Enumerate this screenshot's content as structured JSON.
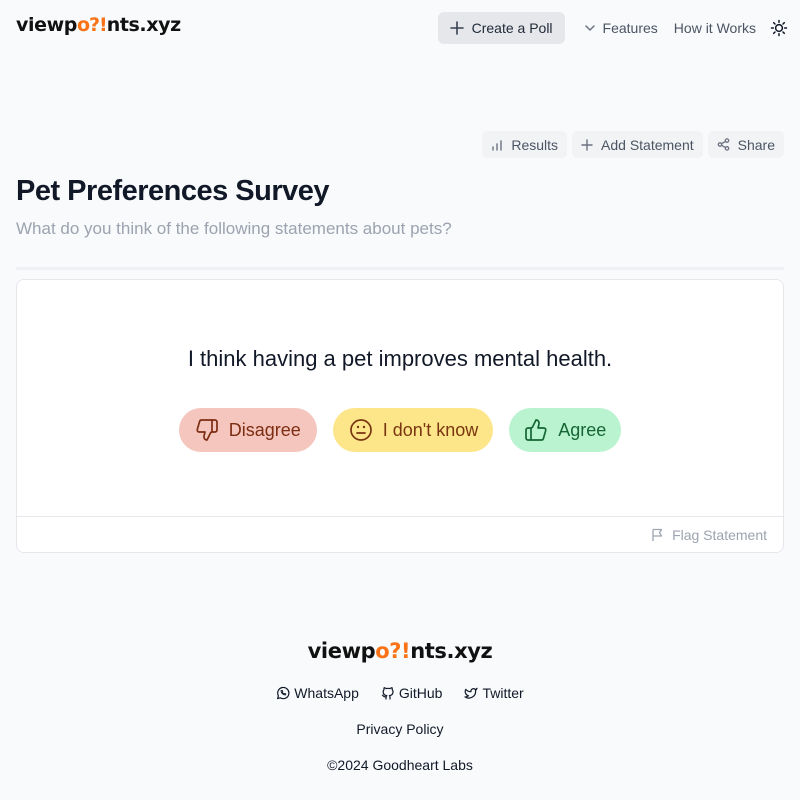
{
  "header": {
    "logo_start": "viewp",
    "logo_mark": "o?!",
    "logo_end": "nts.xyz",
    "create_poll": "Create a Poll",
    "features": "Features",
    "how_it_works": "How it Works"
  },
  "toolbar": {
    "results": "Results",
    "add_statement": "Add Statement",
    "share": "Share"
  },
  "poll": {
    "title": "Pet Preferences Survey",
    "subtitle": "What do you think of the following statements about pets?",
    "statement": "I think having a pet improves mental health.",
    "disagree": "Disagree",
    "unknown": "I don't know",
    "agree": "Agree",
    "flag": "Flag Statement"
  },
  "footer": {
    "logo_start": "viewp",
    "logo_mark": "o?!",
    "logo_end": "nts.xyz",
    "whatsapp": "WhatsApp",
    "github": "GitHub",
    "twitter": "Twitter",
    "privacy": "Privacy Policy",
    "copyright": "©2024 Goodheart Labs"
  },
  "icons": {
    "plus": "plus-icon",
    "chevron": "chevron-down-icon",
    "theme": "sun-icon",
    "results": "bar-chart-icon",
    "share": "share-icon",
    "disagree": "thumbs-down-icon",
    "unknown": "meh-face-icon",
    "agree": "thumbs-up-icon",
    "flag": "flag-icon"
  },
  "colors": {
    "accent": "#f97316",
    "disagree_bg": "#f4c6bd",
    "unknown_bg": "#fde68a",
    "agree_bg": "#b9f3cf"
  }
}
